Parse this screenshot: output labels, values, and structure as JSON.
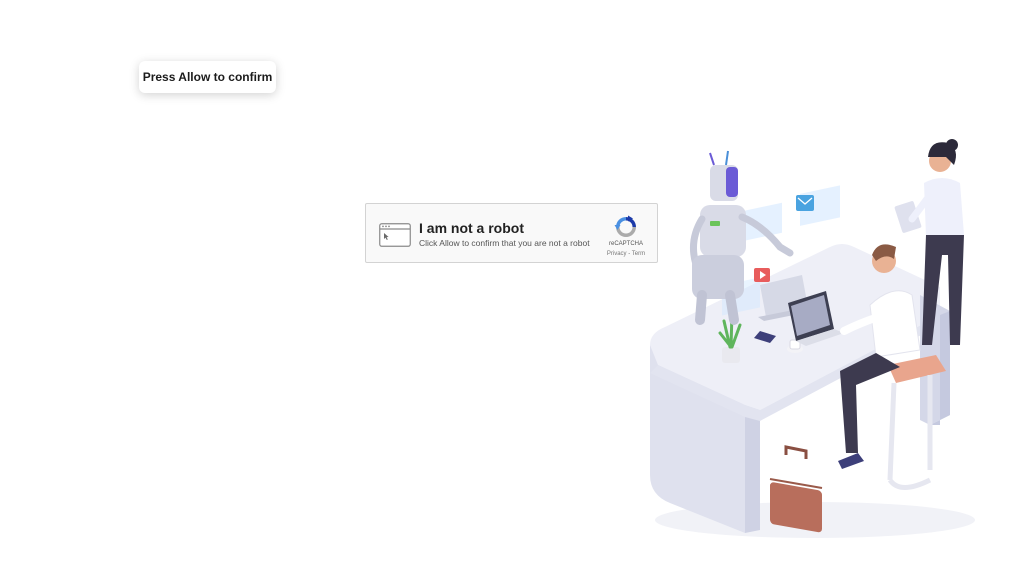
{
  "tooltip": {
    "text": "Press Allow to confirm"
  },
  "captcha": {
    "title": "I am not a robot",
    "subtitle": "Click Allow to confirm that you are not a robot",
    "badge_label": "reCAPTCHA",
    "privacy_link": "Privacy",
    "separator": " - ",
    "terms_link": "Term"
  },
  "icons": {
    "window": "browser-window-cursor-icon",
    "recaptcha": "recaptcha-logo-icon"
  },
  "colors": {
    "recaptcha_blue": "#1c3aa9",
    "recaptcha_light_blue": "#4a90e2",
    "recaptcha_grey": "#ababab",
    "robot_purple": "#6b5bd6",
    "shirt_white": "#ffffff",
    "pants_dark": "#3d3a4f",
    "desk": "#e8e9f3",
    "briefcase": "#b86e5c",
    "stool_seat": "#e9a58d"
  }
}
